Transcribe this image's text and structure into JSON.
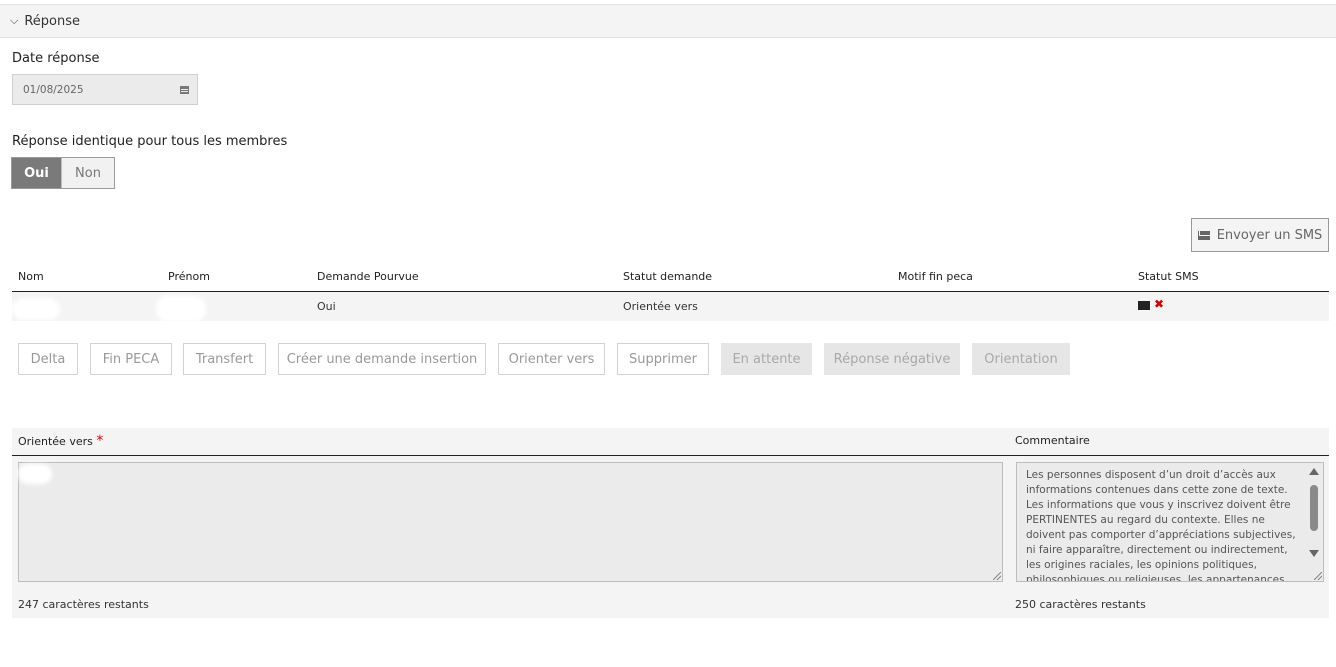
{
  "section": {
    "title": "Réponse",
    "chevron": "chevron-down-icon"
  },
  "date": {
    "label": "Date réponse",
    "value": "01/08/2025",
    "icon": "calendar-icon"
  },
  "identical": {
    "label": "Réponse identique pour tous les membres",
    "yes": "Oui",
    "no": "Non",
    "selected": "Oui"
  },
  "sms_button": {
    "label": "Envoyer un SMS",
    "icon": "envelope-icon"
  },
  "table": {
    "headers": [
      "Nom",
      "Prénom",
      "Demande Pourvue",
      "Statut demande",
      "Motif fin peca",
      "Statut SMS"
    ],
    "rows": [
      {
        "nom": "",
        "prenom": "",
        "demande_pourvue": "Oui",
        "statut_demande": "Orientée vers",
        "motif": "",
        "statut_sms_icons": [
          "envelope-icon",
          "cross-icon"
        ]
      }
    ]
  },
  "actions": {
    "delta": "Delta",
    "fin_peca": "Fin PECA",
    "transfert": "Transfert",
    "creer": "Créer une demande insertion",
    "orienter": "Orienter vers",
    "supprimer": "Supprimer",
    "attente": "En attente",
    "negative": "Réponse négative",
    "orientation": "Orientation"
  },
  "form": {
    "orientee_label": "Orientée vers",
    "required_mark": "*",
    "orientee_counter": "247 caractères restants",
    "comment_label": "Commentaire",
    "comment_text": "Les personnes disposent d’un droit d’accès aux informations contenues dans cette zone de texte. Les informations que vous y inscrivez doivent être PERTINENTES au regard du contexte. Elles ne doivent pas comporter d’appréciations subjectives, ni faire apparaître, directement ou indirectement, les origines raciales, les opinions politiques, philosophiques ou religieuses, les appartenances syndicales ou les",
    "comment_counter": "250 caractères restants"
  }
}
